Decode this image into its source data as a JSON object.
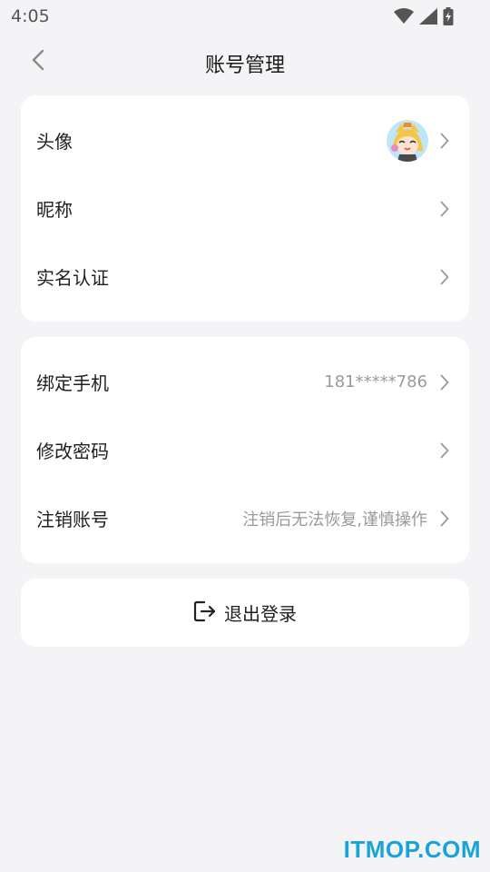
{
  "status_bar": {
    "time": "4:05",
    "icons": [
      "wifi-icon",
      "signal-icon",
      "battery-charging-icon"
    ]
  },
  "nav": {
    "title": "账号管理",
    "back_icon": "chevron-left-icon"
  },
  "profile_section": {
    "items": [
      {
        "label": "头像",
        "value": "",
        "has_avatar": true
      },
      {
        "label": "昵称",
        "value": ""
      },
      {
        "label": "实名认证",
        "value": ""
      }
    ]
  },
  "security_section": {
    "items": [
      {
        "label": "绑定手机",
        "value": "181*****786"
      },
      {
        "label": "修改密码",
        "value": ""
      },
      {
        "label": "注销账号",
        "value": "注销后无法恢复,谨慎操作"
      }
    ]
  },
  "logout": {
    "label": "退出登录",
    "icon": "logout-icon"
  },
  "watermark": {
    "text": "ITMOP.COM"
  },
  "colors": {
    "background": "#f4f4f7",
    "card": "#ffffff",
    "secondary_text": "#9a9a9a",
    "watermark": "#1aa3d9"
  }
}
